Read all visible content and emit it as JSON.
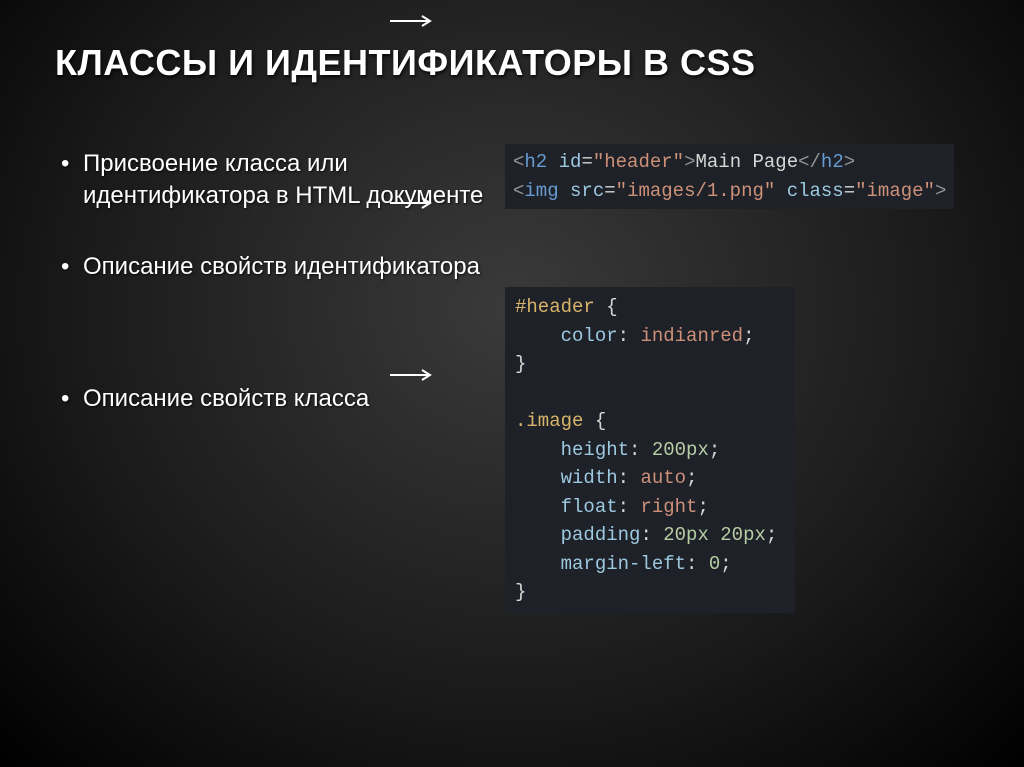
{
  "title": "КЛАССЫ И ИДЕНТИФИКАТОРЫ В CSS",
  "bullets": {
    "b1": "Присвоение класса или идентификатора в HTML документе",
    "b2": "Описание свойств идентификатора",
    "b3": "Описание свойств класса"
  },
  "code1": {
    "l1": {
      "open": "<",
      "tag": "h2",
      "sp": " ",
      "attr": "id",
      "eq": "=",
      "q1": "\"",
      "val": "header",
      "q2": "\"",
      "gt": ">",
      "text": "Main Page",
      "co": "</",
      "ctag": "h2",
      "cgt": ">"
    },
    "l2": {
      "open": "<",
      "tag": "img",
      "sp": " ",
      "attr1": "src",
      "eq1": "=",
      "q1": "\"",
      "val1": "images/1.png",
      "q2": "\"",
      "sp2": " ",
      "attr2": "class",
      "eq2": "=",
      "q3": "\"",
      "val2": "image",
      "q4": "\"",
      "gt": ">"
    }
  },
  "code2": {
    "sel1": "#header",
    "ob": " {",
    "p1": {
      "indent": "    ",
      "name": "color",
      "colon": ": ",
      "val": "indianred",
      "semi": ";"
    },
    "cb": "}",
    "blank": "",
    "sel2": ".image",
    "ob2": " {",
    "p2": {
      "indent": "    ",
      "name": "height",
      "colon": ": ",
      "val": "200px",
      "semi": ";"
    },
    "p3": {
      "indent": "    ",
      "name": "width",
      "colon": ": ",
      "val": "auto",
      "semi": ";"
    },
    "p4": {
      "indent": "    ",
      "name": "float",
      "colon": ": ",
      "val": "right",
      "semi": ";"
    },
    "p5": {
      "indent": "    ",
      "name": "padding",
      "colon": ": ",
      "val": "20px 20px",
      "semi": ";"
    },
    "p6": {
      "indent": "    ",
      "name": "margin-left",
      "colon": ": ",
      "val": "0",
      "semi": ";"
    },
    "cb2": "}"
  }
}
